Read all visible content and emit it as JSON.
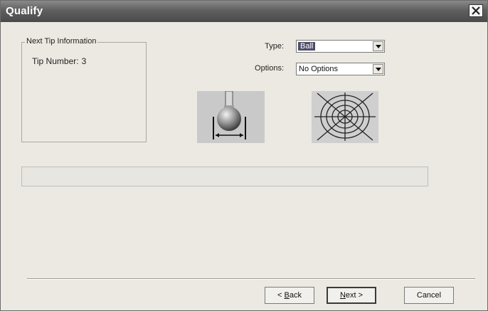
{
  "window": {
    "title": "Qualify"
  },
  "tip_info": {
    "legend": "Next Tip Information",
    "tip_number_label": "Tip Number:",
    "tip_number_value": "3"
  },
  "type_field": {
    "label": "Type:",
    "value": "Ball"
  },
  "options_field": {
    "label": "Options:",
    "value": "No Options"
  },
  "progress": {
    "fraction": 0
  },
  "buttons": {
    "back": {
      "prefix": "< ",
      "mnemonic": "B",
      "rest": "ack"
    },
    "next": {
      "mnemonic": "N",
      "rest": "ext >"
    },
    "cancel": "Cancel"
  },
  "icons": {
    "close": "close-icon",
    "probe": "ball-probe-icon",
    "pattern": "qualification-pattern-icon",
    "dropdown": "chevron-down-icon"
  }
}
